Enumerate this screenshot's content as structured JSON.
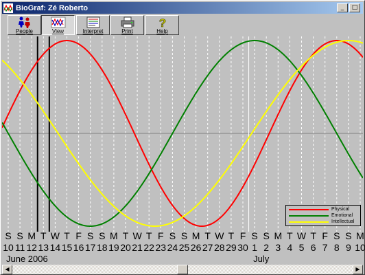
{
  "window": {
    "title": "BioGraf: Zé Roberto"
  },
  "caption_buttons": [
    {
      "name": "minimize-button",
      "glyph": "_"
    },
    {
      "name": "maximize-button",
      "glyph": "□"
    },
    {
      "name": "close-button",
      "glyph": "✕"
    }
  ],
  "toolbar": [
    {
      "name": "people-button",
      "label": "People",
      "icon": "people-icon",
      "pressed": false
    },
    {
      "name": "view-button",
      "label": "View",
      "icon": "chart-icon",
      "pressed": true
    },
    {
      "name": "interpret-button",
      "label": "Interpret",
      "icon": "document-icon",
      "pressed": false
    },
    {
      "name": "print-button",
      "label": "Print",
      "icon": "printer-icon",
      "pressed": false
    },
    {
      "name": "help-button",
      "label": "Help",
      "icon": "question-icon",
      "pressed": false
    }
  ],
  "legend": {
    "items": [
      {
        "label": "Physical",
        "color": "#ff0000"
      },
      {
        "label": "Emotional",
        "color": "#008000"
      },
      {
        "label": "Intellectual",
        "color": "#ffff00"
      }
    ]
  },
  "days": [
    {
      "letter": "S",
      "num": "10"
    },
    {
      "letter": "S",
      "num": "11"
    },
    {
      "letter": "M",
      "num": "12"
    },
    {
      "letter": "T",
      "num": "13"
    },
    {
      "letter": "W",
      "num": "14"
    },
    {
      "letter": "T",
      "num": "15"
    },
    {
      "letter": "F",
      "num": "16"
    },
    {
      "letter": "S",
      "num": "17"
    },
    {
      "letter": "S",
      "num": "18"
    },
    {
      "letter": "M",
      "num": "19"
    },
    {
      "letter": "T",
      "num": "20"
    },
    {
      "letter": "W",
      "num": "21"
    },
    {
      "letter": "T",
      "num": "22"
    },
    {
      "letter": "F",
      "num": "23"
    },
    {
      "letter": "S",
      "num": "24"
    },
    {
      "letter": "S",
      "num": "25"
    },
    {
      "letter": "M",
      "num": "26"
    },
    {
      "letter": "T",
      "num": "27"
    },
    {
      "letter": "W",
      "num": "28"
    },
    {
      "letter": "T",
      "num": "29"
    },
    {
      "letter": "F",
      "num": "30"
    },
    {
      "letter": "S",
      "num": "1"
    },
    {
      "letter": "S",
      "num": "2"
    },
    {
      "letter": "M",
      "num": "3"
    },
    {
      "letter": "T",
      "num": "4"
    },
    {
      "letter": "W",
      "num": "5"
    },
    {
      "letter": "T",
      "num": "6"
    },
    {
      "letter": "F",
      "num": "7"
    },
    {
      "letter": "S",
      "num": "8"
    },
    {
      "letter": "S",
      "num": "9"
    },
    {
      "letter": "M",
      "num": "10"
    }
  ],
  "months": [
    {
      "label": "June 2006",
      "start_index": 0
    },
    {
      "label": "July",
      "start_index": 21
    }
  ],
  "markers": {
    "highlight_days": [
      "13"
    ]
  },
  "chart_data": {
    "type": "line",
    "x": [
      "2006-06-10",
      "2006-06-11",
      "2006-06-12",
      "2006-06-13",
      "2006-06-14",
      "2006-06-15",
      "2006-06-16",
      "2006-06-17",
      "2006-06-18",
      "2006-06-19",
      "2006-06-20",
      "2006-06-21",
      "2006-06-22",
      "2006-06-23",
      "2006-06-24",
      "2006-06-25",
      "2006-06-26",
      "2006-06-27",
      "2006-06-28",
      "2006-06-29",
      "2006-06-30",
      "2006-07-01",
      "2006-07-02",
      "2006-07-03",
      "2006-07-04",
      "2006-07-05",
      "2006-07-06",
      "2006-07-07",
      "2006-07-08",
      "2006-07-09",
      "2006-07-10"
    ],
    "ylim": [
      -1,
      1
    ],
    "series": [
      {
        "name": "Physical",
        "color": "#ff0000",
        "period_days": 23,
        "peak_day": "2006-06-15"
      },
      {
        "name": "Emotional",
        "color": "#008000",
        "period_days": 28,
        "peak_day": "2006-07-01"
      },
      {
        "name": "Intellectual",
        "color": "#ffff00",
        "period_days": 33,
        "peak_day": "2006-07-09"
      }
    ],
    "grid": true
  },
  "scrollbar": {
    "left_glyph": "◀",
    "right_glyph": "▶",
    "position": 0.5
  }
}
